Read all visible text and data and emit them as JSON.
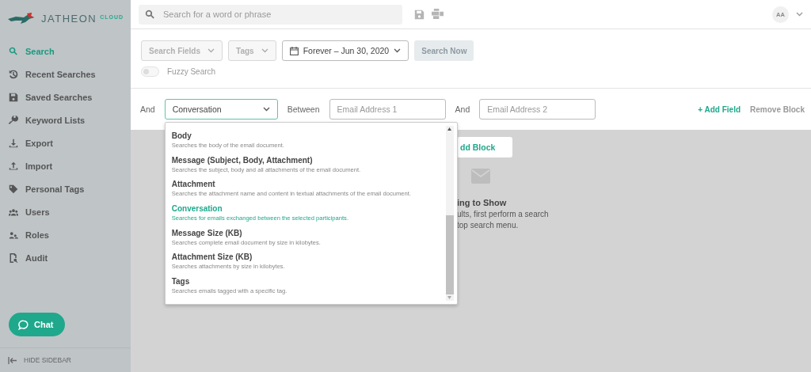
{
  "brand": {
    "name": "JATHEON",
    "suffix": "CLOUD"
  },
  "sidebar": {
    "items": [
      {
        "label": "Search",
        "selected": true
      },
      {
        "label": "Recent Searches",
        "selected": false
      },
      {
        "label": "Saved Searches",
        "selected": false
      },
      {
        "label": "Keyword Lists",
        "selected": false
      },
      {
        "label": "Export",
        "selected": false
      },
      {
        "label": "Import",
        "selected": false
      },
      {
        "label": "Personal Tags",
        "selected": false
      },
      {
        "label": "Users",
        "selected": false
      },
      {
        "label": "Roles",
        "selected": false
      },
      {
        "label": "Audit",
        "selected": false
      }
    ],
    "chat_button": "Chat",
    "hide_sidebar": "HIDE SIDEBAR"
  },
  "top_bar": {
    "search": {
      "placeholder": "Search for a word or phrase"
    },
    "avatar": "AA"
  },
  "filters": {
    "search_fields": "Search Fields",
    "tags": "Tags",
    "date_range": "Forever – Jun 30, 2020",
    "search_button": {
      "label": "Search Now",
      "disabled": true
    },
    "fuzzy_search": {
      "label": "Fuzzy Search",
      "on": false
    }
  },
  "block": {
    "operator": "And",
    "field": "Conversation",
    "between": "Between",
    "email_1": {
      "placeholder": "Email Address 1"
    },
    "and": "And",
    "email_2": {
      "placeholder": "Email Address 2"
    },
    "add_field": "+ Add Field",
    "remove_block": "Remove Block"
  },
  "field_menu": {
    "items": [
      {
        "title": "Body",
        "description": "Searches the body of the email document.",
        "selected": false
      },
      {
        "title": "Message (Subject, Body, Attachment)",
        "description": "Searches the subject, body and all attachments of the email document.",
        "selected": false
      },
      {
        "title": "Attachment",
        "description": "Searches the attachment name and content in textual attachments of the email document.",
        "selected": false
      },
      {
        "title": "Conversation",
        "description": "Searches for emails exchanged between the selected participants.",
        "selected": true
      },
      {
        "title": "Message Size (KB)",
        "description": "Searches complete email document by size in kilobytes.",
        "selected": false
      },
      {
        "title": "Attachment Size (KB)",
        "description": "Searches attachments by size in kilobytes.",
        "selected": false
      },
      {
        "title": "Tags",
        "description": "Searches emails tagged with a specific tag.",
        "selected": false
      }
    ]
  },
  "empty_state": {
    "add_block": "dd Block",
    "title": "ing to Show",
    "lines": [
      "ults, first perform a search",
      "top search menu."
    ]
  }
}
